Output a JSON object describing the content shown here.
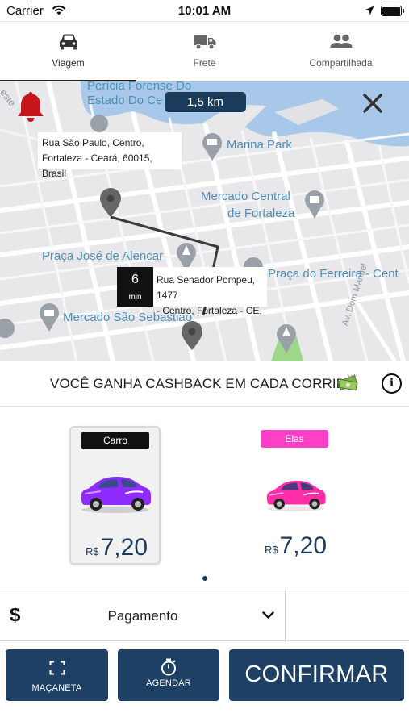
{
  "status_bar": {
    "carrier": "Carrier",
    "time": "10:01 AM"
  },
  "tabs": [
    {
      "label": "Viagem",
      "icon": "car-icon",
      "active": true
    },
    {
      "label": "Frete",
      "icon": "truck-icon",
      "active": false
    },
    {
      "label": "Compartilhada",
      "icon": "people-icon",
      "active": false
    }
  ],
  "map": {
    "distance": "1,5 km",
    "origin_address_line1": "Rua São Paulo, Centro,",
    "origin_address_line2": "Fortaleza - Ceará, 60015, Brasil",
    "eta_minutes": "6",
    "eta_unit": "min",
    "destination_address_line1": "Rua Senador Pompeu, 1477",
    "destination_address_line2": "- Centro, Fortaleza - CE,",
    "places": {
      "pericia_line1": "Perícia Forense Do",
      "pericia_line2": "Estado Do Ce",
      "marina_park": "Marina Park",
      "mercado_central_line1": "Mercado Central",
      "mercado_central_line2": "de Fortaleza",
      "praca_jose": "Praça José de Alencar",
      "praca_ferreira": "Praça do Ferreira - Cent",
      "mercado_sao": "Mercado São Sebastião",
      "av_dom_manuel": "Av. Dom Manuel",
      "este_edge": "este"
    },
    "colors": {
      "water": "#a7c8e8",
      "route": "#3a3a3a",
      "pin": "#666666",
      "alarm": "#c4161c"
    }
  },
  "cashback": {
    "text": "VOCÊ GANHA CASHBACK EM CADA CORRIDA",
    "icon": "money-icon"
  },
  "vehicles": [
    {
      "badge": "Carro",
      "currency": "R$",
      "price": "7,20",
      "car_color": "#8e2cff",
      "badge_color": "#111111",
      "selected": true
    },
    {
      "badge": "Elas",
      "currency": "R$",
      "price": "7,20",
      "car_color": "#ff2ea8",
      "badge_color": "#ff3fc8",
      "selected": false
    }
  ],
  "payment": {
    "icon": "dollar-icon",
    "symbol": "$",
    "label": "Pagamento"
  },
  "actions": {
    "handle_label": "MAÇANETA",
    "schedule_label": "AGENDAR",
    "confirm_label": "CONFIRMAR",
    "button_color": "#1e4065"
  }
}
